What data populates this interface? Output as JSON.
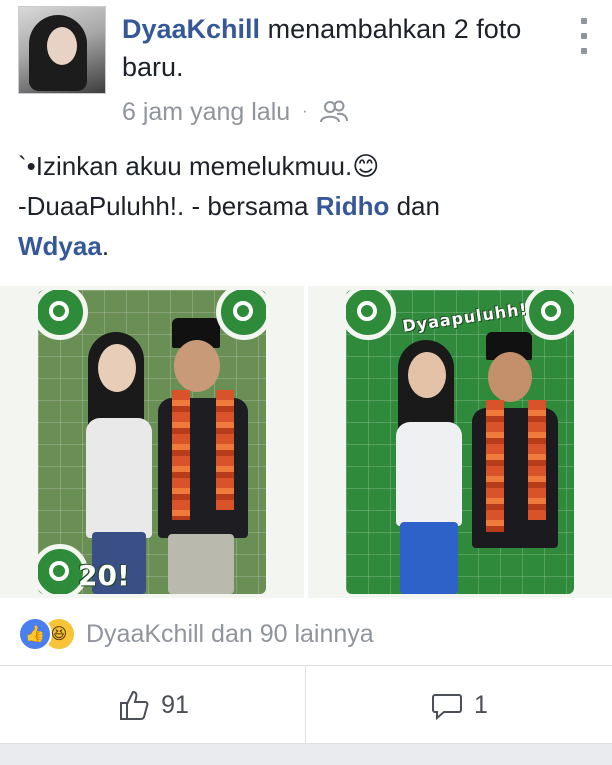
{
  "post": {
    "author": "DyaaKchill",
    "action_text": "menambahkan 2 foto baru.",
    "time": "6 jam yang lalu",
    "separator": "·",
    "privacy_icon": "friends-icon",
    "menu_icon": "more-vertical-icon"
  },
  "caption": {
    "line1": "`•Izinkan akuu memelukmuu.😊",
    "line2_prefix": "-DuaaPuluhh!. - bersama ",
    "tag1": "Ridho",
    "conj": " dan ",
    "tag2": "Wdyaa",
    "end": "."
  },
  "photos": [
    {
      "overlay_text": "20!",
      "alt": "photo-1"
    },
    {
      "overlay_text": "Dyaapuluhh!",
      "alt": "photo-2"
    }
  ],
  "reactions": {
    "icons": [
      "like-reaction-icon",
      "haha-reaction-icon"
    ],
    "summary": "DyaaKchill dan 90 lainnya"
  },
  "actions": {
    "like_count": "91",
    "comment_count": "1",
    "like_icon": "thumbs-up-icon",
    "comment_icon": "comment-icon"
  },
  "colors": {
    "link": "#365899",
    "meta": "#90949c",
    "like_blue": "#4a7ff0",
    "haha_yellow": "#f7c437",
    "photo_green": "#2f8a3c"
  }
}
